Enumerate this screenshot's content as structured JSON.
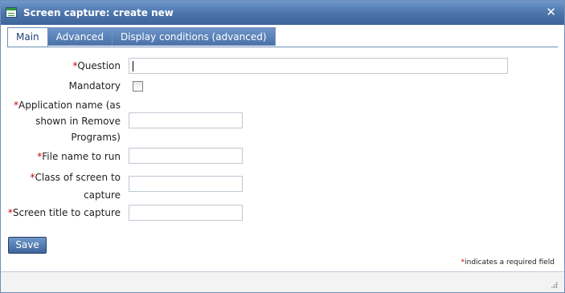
{
  "window": {
    "title": "Screen capture: create new",
    "close_glyph": "✕"
  },
  "tabs": [
    {
      "label": "Main",
      "active": true
    },
    {
      "label": "Advanced",
      "active": false
    },
    {
      "label": "Display conditions (advanced)",
      "active": false
    }
  ],
  "form": {
    "required_marker": "*",
    "question_label": "Question",
    "question_value": "",
    "mandatory_label": "Mandatory",
    "mandatory_checked": false,
    "application_label_line1": "Application name (as",
    "application_label_line2": "shown in Remove",
    "application_label_line3": "Programs)",
    "application_value": "",
    "file_label": "File name to run",
    "file_value": "",
    "class_label_line1": "Class of screen to",
    "class_label_line2": "capture",
    "class_value": "",
    "title_label": "Screen title to capture",
    "title_value": ""
  },
  "actions": {
    "save_label": "Save"
  },
  "footer": {
    "required_note": "indicates a required field"
  },
  "icons": {
    "app": "app-window-icon",
    "close": "close-icon",
    "resize": "resize-grip-icon"
  }
}
